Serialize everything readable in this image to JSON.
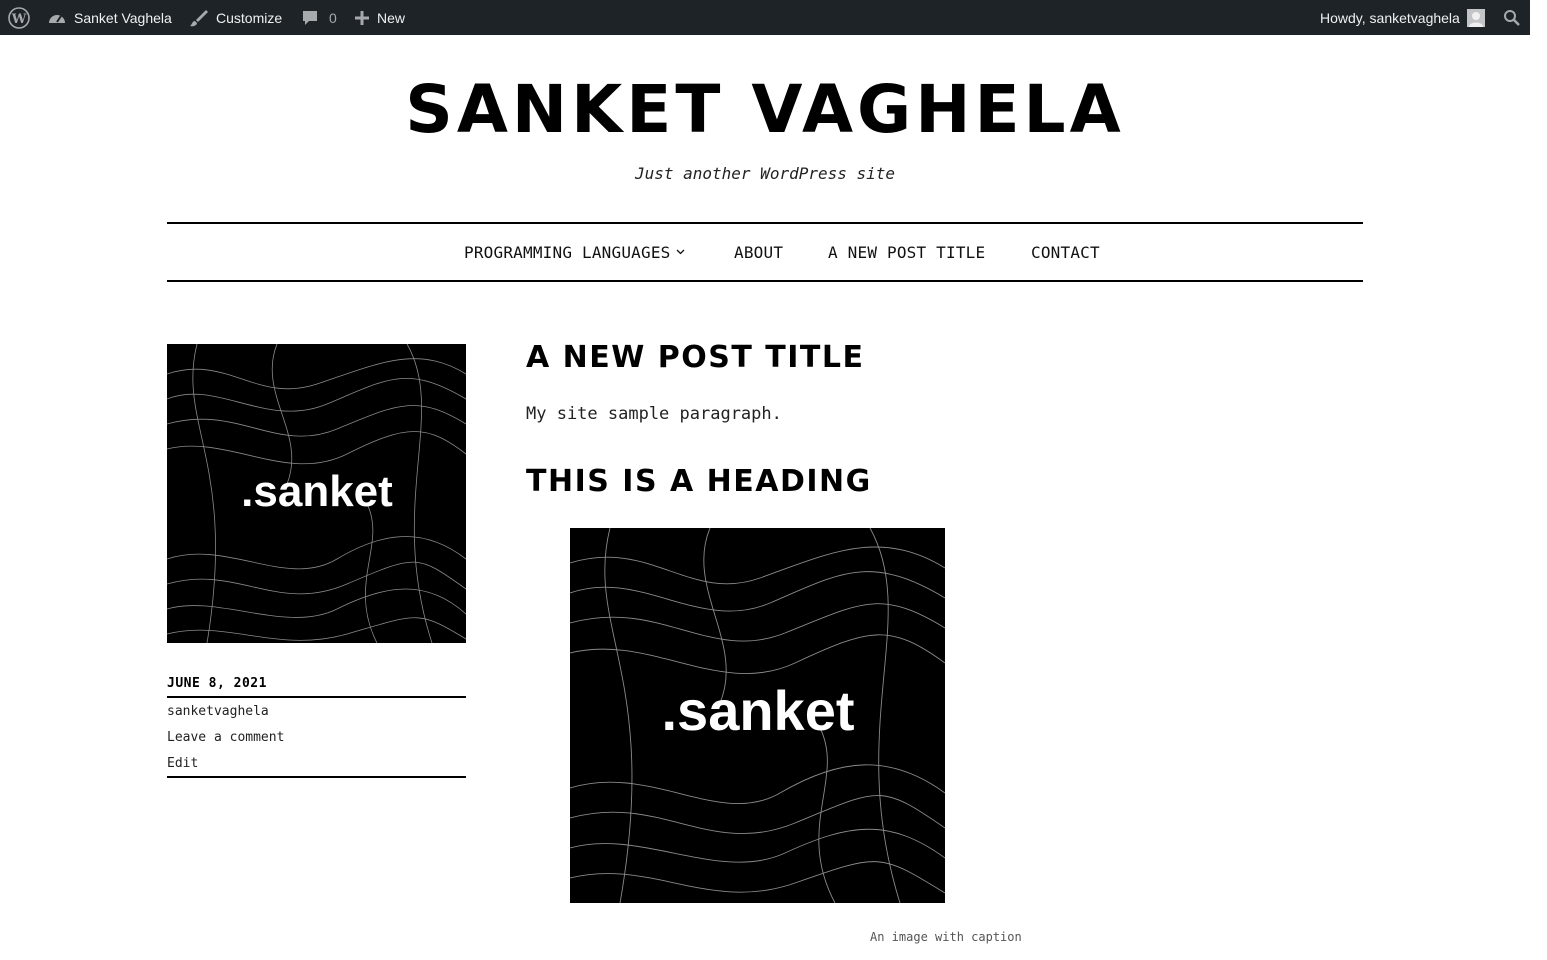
{
  "admin_bar": {
    "site_name": "Sanket Vaghela",
    "customize": "Customize",
    "comments_count": "0",
    "new_label": "New",
    "howdy": "Howdy, sanketvaghela"
  },
  "header": {
    "site_title": "SANKET VAGHELA",
    "tagline": "Just another WordPress site"
  },
  "nav": {
    "items": [
      {
        "label": "PROGRAMMING LANGUAGES"
      },
      {
        "label": "ABOUT"
      },
      {
        "label": "A NEW POST TITLE"
      },
      {
        "label": "CONTACT"
      }
    ]
  },
  "post": {
    "featured_image_text": ".sanket",
    "date": "JUNE 8, 2021",
    "author": "sanketvaghela",
    "comment_link": "Leave a comment",
    "edit_link": "Edit",
    "title": "A NEW POST TITLE",
    "paragraph": "My site sample paragraph.",
    "heading": "THIS IS A HEADING",
    "content_image_text": ".sanket",
    "caption": "An image with caption"
  }
}
